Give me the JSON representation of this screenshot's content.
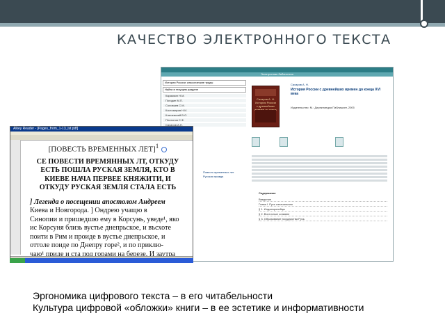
{
  "slide": {
    "title": "КАЧЕСТВО ЭЛЕКТРОННОГО ТЕКСТА",
    "caption_lines": [
      "Эргономика цифрового текста – в его читабельности",
      "Культура цифровой «обложки» книги – в ее эстетике и информативности"
    ]
  },
  "reader": {
    "window_title": "Alkey Reader - [Pages_from_1-13_lst.pdf]",
    "page_header": "[ПОВЕСТЬ ВРЕМЕННЫХ ЛЕТ]",
    "superscript": "1",
    "title_lines": [
      "СЕ ПОВЕСТИ ВРЕМЯННЫХ ЛТ, ОТКУДУ",
      "ЕСТЬ ПОШЛА РУСКАЯ ЗЕМЛЯ, КТО В",
      "КИЕВЕ НАЧА ПЕРВЕЕ КНЯЖИТИ, И",
      "ОТКУДУ РУСКАЯ ЗЕМЛЯ СТАЛА ЕСТЬ"
    ],
    "body_lines": [
      "] Легенда о посещении апостолом Андреем",
      "Киева и Новгорода. ] Ондрею учащю в",
      "Синопии и пришедшю ему в Корсунь, уведе¹, яко",
      "ис Корсуня близь вустье днепрьское, и въсхоте",
      "поити в Рим и проиде в вустье днепрьское, и",
      "оттоле поиде по Днепру горе², и по приклю-",
      "чаю¹ приде и ста под горами на березе. И заутра"
    ]
  },
  "library": {
    "header": "Электронная библиотека",
    "side_select": "История России: классические труды",
    "side_search": "Найти в текущем разделе",
    "side_items": [
      "Карамзин Н.М.",
      "Погодин М.П.",
      "Соловьев С.М.",
      "Костомаров Н.И.",
      "Ключевский В.О.",
      "Платонов С.Ф.",
      "Сахаров А.Н."
    ],
    "author": "Сахаров А. Н.",
    "book_title": "История России с древнейших времен до конца XVI века",
    "publisher": "Издательство: М.: Директмедиа Паблишинг, 2005",
    "cover_title": "Сахаров А. Н. История России с древнейших времен до конца XVI века",
    "links": [
      "Повесть временных лет",
      "Русская правда"
    ],
    "toc_head": "Содержание",
    "toc_items": [
      "Введение",
      "Глава I. Русь изначальная",
      "§ 1. Индоевропейцы",
      "§ 2. Восточные славяне",
      "§ 3. Образование государства Русь"
    ]
  }
}
